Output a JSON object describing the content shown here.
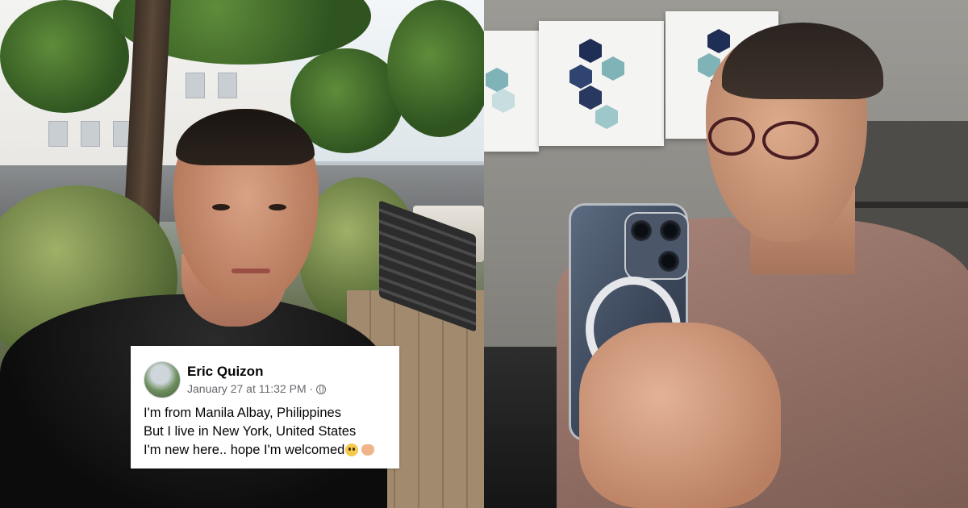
{
  "post": {
    "author_name": "Eric Quizon",
    "timestamp": "January 27 at 11:32 PM ·",
    "audience_icon": "globe-icon",
    "lines": [
      "I'm from Manila Albay, Philippines",
      "But I live in New York, United States",
      "I'm new here.. hope I'm welcomed"
    ],
    "emojis": [
      "pleading-face-emoji",
      "open-hands-emoji"
    ]
  },
  "colors": {
    "card_background": "#ffffff",
    "name_text": "#050505",
    "meta_text": "#65676b"
  }
}
